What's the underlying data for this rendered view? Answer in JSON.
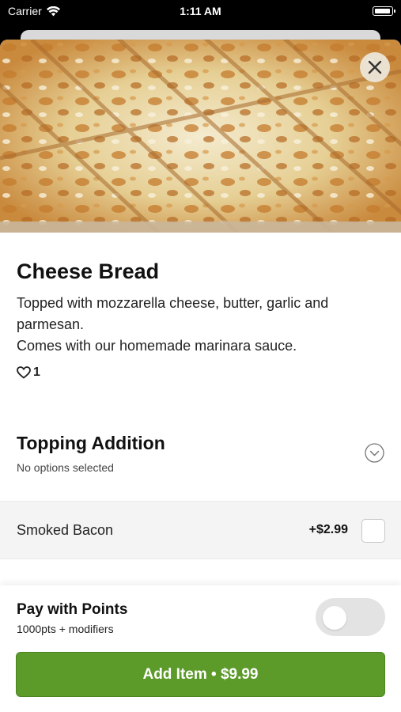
{
  "status_bar": {
    "carrier": "Carrier",
    "time": "1:11 AM",
    "icons": [
      "wifi-icon",
      "battery-icon"
    ]
  },
  "hero_image": {
    "alt": "Cheese bread photo"
  },
  "close_icon": "close-icon",
  "item": {
    "title": "Cheese Bread",
    "description_lines": [
      "Topped with mozzarella cheese, butter, garlic and parmesan.",
      "Comes with our homemade marinara sauce."
    ],
    "likes": "1",
    "like_icon": "heart-icon"
  },
  "modifier_group": {
    "title": "Topping Addition",
    "subtitle": "No options selected",
    "expand_icon": "chevron-down-icon",
    "options": [
      {
        "name": "Smoked Bacon",
        "price": "+$2.99",
        "checked": false
      }
    ]
  },
  "points": {
    "title": "Pay with Points",
    "subtitle": "1000pts + modifiers",
    "enabled": false
  },
  "add_button": {
    "label": "Add Item • $9.99"
  },
  "colors": {
    "accent": "#5c9a2a",
    "toggle_off": "#e3e3e3"
  }
}
